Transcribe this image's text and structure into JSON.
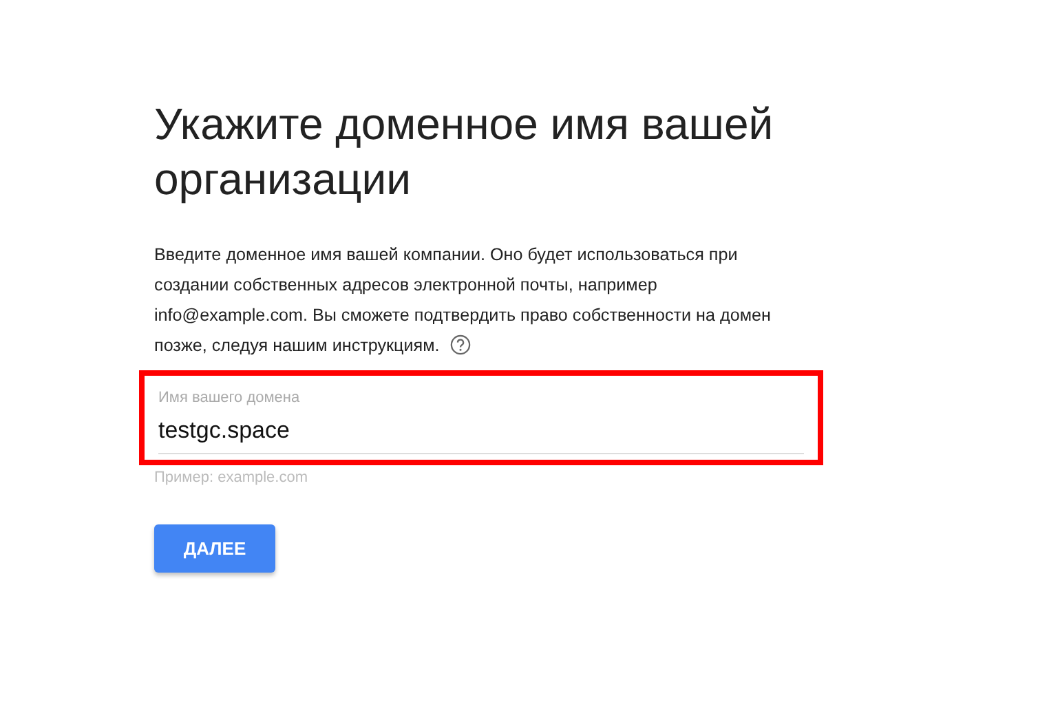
{
  "heading": "Укажите доменное имя вашей организации",
  "description": "Введите доменное имя вашей компании. Оно будет использоваться при создании собственных адресов электронной почты, например info@example.com. Вы сможете подтвердить право собственности на домен позже, следуя нашим инструкциям.",
  "domain_field": {
    "label": "Имя вашего домена",
    "value": "testgc.space",
    "hint": "Пример: example.com",
    "highlighted": true
  },
  "buttons": [
    {
      "label": "ДАЛЕЕ"
    }
  ]
}
